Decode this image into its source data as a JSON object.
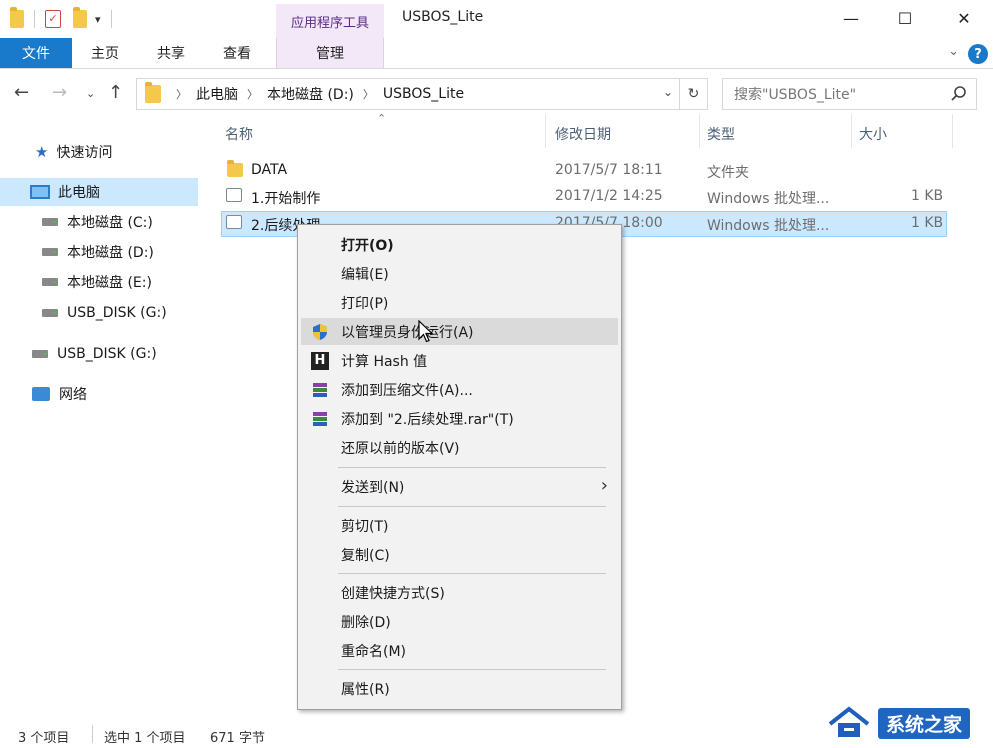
{
  "window": {
    "title": "USBOS_Lite",
    "context_tab_group": "应用程序工具",
    "minimize_glyph": "—",
    "maximize_glyph": "☐",
    "close_glyph": "✕"
  },
  "ribbon": {
    "tabs": [
      {
        "label": "文件"
      },
      {
        "label": "主页"
      },
      {
        "label": "共享"
      },
      {
        "label": "查看"
      },
      {
        "label": "管理"
      }
    ],
    "help_label": "?",
    "accent_color": "#1979ca"
  },
  "address_bar": {
    "crumbs": [
      "此电脑",
      "本地磁盘 (D:)",
      "USBOS_Lite"
    ],
    "search_placeholder": "搜索\"USBOS_Lite\""
  },
  "sidebar": {
    "items": [
      {
        "label": "快速访问",
        "icon": "star-icon"
      },
      {
        "label": "此电脑",
        "icon": "computer-icon"
      },
      {
        "label": "本地磁盘 (C:)",
        "icon": "drive-icon"
      },
      {
        "label": "本地磁盘 (D:)",
        "icon": "drive-icon"
      },
      {
        "label": "本地磁盘 (E:)",
        "icon": "drive-icon"
      },
      {
        "label": "USB_DISK (G:)",
        "icon": "drive-icon"
      },
      {
        "label": "USB_DISK (G:)",
        "icon": "drive-icon"
      },
      {
        "label": "网络",
        "icon": "network-icon"
      }
    ]
  },
  "file_list": {
    "columns": [
      "名称",
      "修改日期",
      "类型",
      "大小"
    ],
    "rows": [
      {
        "name": "DATA",
        "date": "2017/5/7 18:11",
        "type": "文件夹",
        "size": "",
        "icon": "folder-icon"
      },
      {
        "name": "1.开始制作",
        "date": "2017/1/2 14:25",
        "type": "Windows 批处理...",
        "size": "1 KB",
        "icon": "batch-file-icon"
      },
      {
        "name": "2.后续处理",
        "date": "2017/5/7 18:00",
        "type": "Windows 批处理...",
        "size": "1 KB",
        "icon": "batch-file-icon"
      }
    ]
  },
  "context_menu": {
    "items": [
      {
        "label": "打开(O)"
      },
      {
        "label": "编辑(E)"
      },
      {
        "label": "打印(P)"
      },
      {
        "label": "以管理员身份运行(A)"
      },
      {
        "label": "计算 Hash 值"
      },
      {
        "label": "添加到压缩文件(A)..."
      },
      {
        "label": "添加到 \"2.后续处理.rar\"(T)"
      },
      {
        "label": "还原以前的版本(V)"
      },
      {
        "label": "发送到(N)"
      },
      {
        "label": "剪切(T)"
      },
      {
        "label": "复制(C)"
      },
      {
        "label": "创建快捷方式(S)"
      },
      {
        "label": "删除(D)"
      },
      {
        "label": "重命名(M)"
      },
      {
        "label": "属性(R)"
      }
    ]
  },
  "status_bar": {
    "item_count": "3 个项目",
    "selection": "选中 1 个项目",
    "size": "671 字节"
  },
  "watermark": {
    "text": "系统之家"
  }
}
